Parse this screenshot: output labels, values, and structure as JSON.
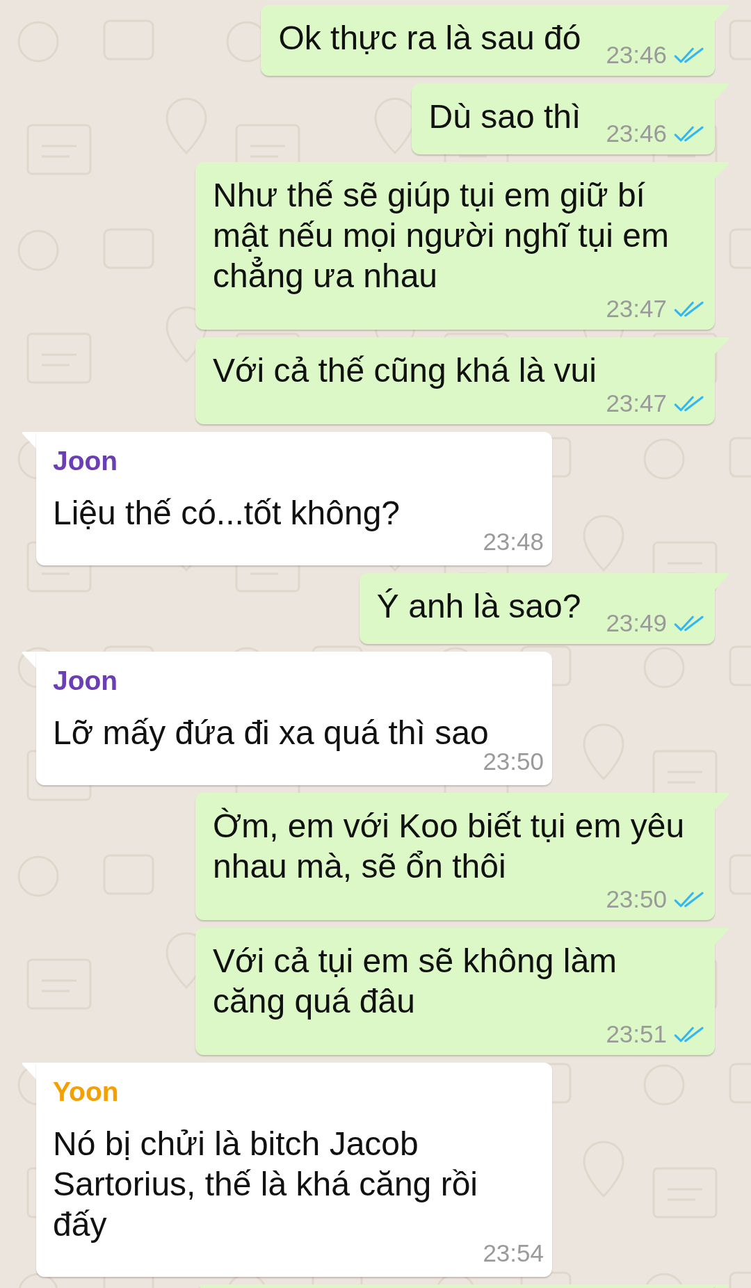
{
  "messages": [
    {
      "kind": "outgoing",
      "text": "Ok thực ra là sau đó",
      "time": "23:46",
      "read": true
    },
    {
      "kind": "outgoing",
      "text": "Dù sao thì",
      "time": "23:46",
      "read": true
    },
    {
      "kind": "outgoing",
      "text": "Như thế sẽ giúp tụi em giữ bí mật nếu mọi người nghĩ tụi em chẳng ưa nhau",
      "time": "23:47",
      "read": true
    },
    {
      "kind": "outgoing",
      "text": "Với cả thế cũng khá là vui",
      "time": "23:47",
      "read": true
    },
    {
      "kind": "incoming",
      "sender": {
        "name": "Joon",
        "color": "#6a3fb6"
      },
      "text": "Liệu thế có...tốt không?",
      "time": "23:48"
    },
    {
      "kind": "outgoing",
      "text": "Ý anh là sao?",
      "time": "23:49",
      "read": true
    },
    {
      "kind": "incoming",
      "sender": {
        "name": "Joon",
        "color": "#6a3fb6"
      },
      "text": "Lỡ mấy đứa đi xa quá thì sao",
      "time": "23:50"
    },
    {
      "kind": "outgoing",
      "text": "Ờm, em với Koo biết tụi em yêu nhau mà, sẽ ổn thôi",
      "time": "23:50",
      "read": true
    },
    {
      "kind": "outgoing",
      "text": "Với cả tụi em sẽ không làm căng quá đâu",
      "time": "23:51",
      "read": true
    },
    {
      "kind": "incoming",
      "sender": {
        "name": "Yoon",
        "color": "#f59f00"
      },
      "text": "Nó bị chửi là bitch Jacob Sartorius, thế là khá căng rồi đấy",
      "time": "23:54"
    },
    {
      "kind": "outgoing"
    }
  ]
}
